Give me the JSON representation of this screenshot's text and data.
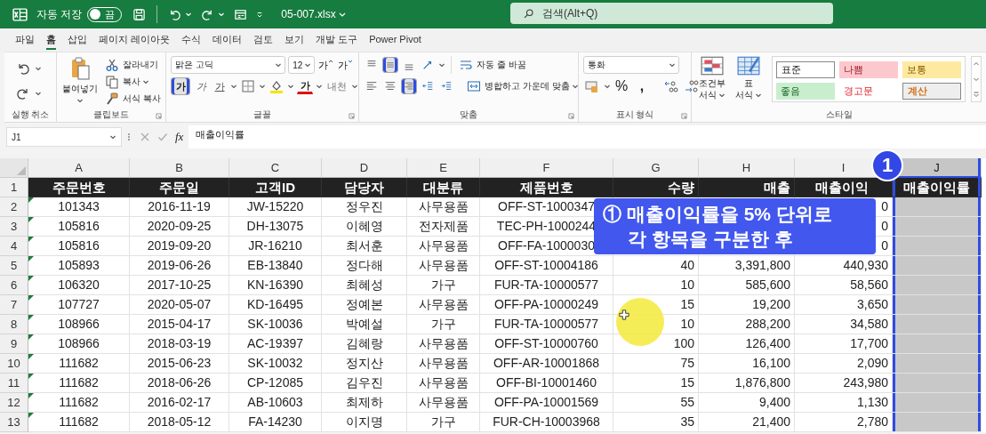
{
  "title_bar": {
    "autosave_label": "자동 저장",
    "autosave": {
      "on": false,
      "label": "끔"
    },
    "filename": "05-007.xlsx",
    "search": {
      "placeholder": "검색(Alt+Q)"
    }
  },
  "tabs": [
    {
      "label": "파일",
      "selected": false
    },
    {
      "label": "홈",
      "selected": true
    },
    {
      "label": "삽입",
      "selected": false
    },
    {
      "label": "페이지 레이아웃",
      "selected": false
    },
    {
      "label": "수식",
      "selected": false
    },
    {
      "label": "데이터",
      "selected": false
    },
    {
      "label": "검토",
      "selected": false
    },
    {
      "label": "보기",
      "selected": false
    },
    {
      "label": "개발 도구",
      "selected": false
    },
    {
      "label": "Power Pivot",
      "selected": false
    }
  ],
  "ribbon": {
    "undo": {
      "label": "실행 취소"
    },
    "clipboard": {
      "label": "클립보드",
      "paste": "붙여넣기",
      "items": [
        {
          "kind": "cut",
          "label": "잘라내기"
        },
        {
          "kind": "copy",
          "label": "복사"
        },
        {
          "kind": "painter",
          "label": "서식 복사"
        }
      ]
    },
    "font": {
      "label": "글꼴",
      "family": "맑은 고딕",
      "size": "12",
      "size_buttons": [
        {
          "kind": "grow",
          "text": "가"
        },
        {
          "kind": "shrink",
          "text": "가"
        }
      ],
      "buttons": [
        {
          "kind": "bold",
          "text": "가",
          "selected": true
        },
        {
          "kind": "italic",
          "text": "가",
          "selected": false
        },
        {
          "kind": "underline",
          "text": "가",
          "selected": false
        },
        {
          "kind": "border",
          "selected": false
        },
        {
          "kind": "fill",
          "selected": false
        },
        {
          "kind": "color",
          "text": "가",
          "selected": false
        },
        {
          "kind": "phonetic",
          "text": "내천",
          "selected": false
        }
      ]
    },
    "alignment": {
      "label": "맞춤",
      "top_buttons": [
        {
          "kind": "top",
          "selected": false
        },
        {
          "kind": "middle",
          "selected": true
        },
        {
          "kind": "bottom",
          "selected": false
        },
        {
          "kind": "orient",
          "selected": false
        }
      ],
      "bottom_buttons": [
        {
          "kind": "left",
          "selected": false
        },
        {
          "kind": "center",
          "selected": false
        },
        {
          "kind": "right",
          "selected": true
        },
        {
          "kind": "outdent",
          "selected": false
        },
        {
          "kind": "indent",
          "selected": false
        }
      ],
      "wrap": "자동 줄 바꿈",
      "merge": "병합하고 가운데 맞춤"
    },
    "number": {
      "label": "표시 형식",
      "format": "통화",
      "percent": "%",
      "comma": ","
    },
    "styles": {
      "label": "스타일",
      "conditional": [
        "조건부",
        "서식"
      ],
      "table": [
        "표",
        "서식"
      ],
      "cells": [
        {
          "label": "표준",
          "kind": "normal"
        },
        {
          "label": "나쁨",
          "kind": "bad"
        },
        {
          "label": "보통",
          "kind": "neutral"
        },
        {
          "label": "좋음",
          "kind": "good"
        },
        {
          "label": "경고문",
          "kind": "warning"
        },
        {
          "label": "계산",
          "kind": "calc"
        }
      ]
    }
  },
  "formula_bar": {
    "name_box": "J1",
    "fx": "fx",
    "formula": "매출이익률"
  },
  "sheet": {
    "columns": [
      {
        "letter": "A",
        "kind": "text",
        "selected": false
      },
      {
        "letter": "B",
        "kind": "text",
        "selected": false
      },
      {
        "letter": "C",
        "kind": "text",
        "selected": false
      },
      {
        "letter": "D",
        "kind": "text",
        "selected": false
      },
      {
        "letter": "E",
        "kind": "text",
        "selected": false
      },
      {
        "letter": "F",
        "kind": "text",
        "selected": false
      },
      {
        "letter": "G",
        "kind": "number",
        "selected": false
      },
      {
        "letter": "H",
        "kind": "number",
        "selected": false
      },
      {
        "letter": "I",
        "kind": "number",
        "selected": false
      },
      {
        "letter": "J",
        "kind": "text",
        "selected": true
      }
    ],
    "rows": [
      {
        "number": "1",
        "kind": "header",
        "flag": false,
        "cells": [
          "주문번호",
          "주문일",
          "고객ID",
          "담당자",
          "대분류",
          "제품번호",
          "수량",
          "매출",
          "매출이익",
          "매출이익률"
        ]
      },
      {
        "number": "2",
        "kind": "data",
        "flag": true,
        "cells": [
          "101343",
          "2016-11-19",
          "JW-15220",
          "정우진",
          "사무용품",
          "OFF-ST-1000347",
          null,
          null,
          "0",
          null
        ]
      },
      {
        "number": "3",
        "kind": "data",
        "flag": true,
        "cells": [
          "105816",
          "2020-09-25",
          "DH-13075",
          "이혜영",
          "전자제품",
          "TEC-PH-1000244",
          null,
          null,
          "0",
          null
        ]
      },
      {
        "number": "4",
        "kind": "data",
        "flag": true,
        "cells": [
          "105816",
          "2019-09-20",
          "JR-16210",
          "최서훈",
          "사무용품",
          "OFF-FA-1000030",
          null,
          null,
          "0",
          null
        ]
      },
      {
        "number": "5",
        "kind": "data",
        "flag": true,
        "cells": [
          "105893",
          "2019-06-26",
          "EB-13840",
          "정다해",
          "사무용품",
          "OFF-ST-10004186",
          "40",
          "3,391,800",
          "440,930",
          null
        ]
      },
      {
        "number": "6",
        "kind": "data",
        "flag": true,
        "cells": [
          "106320",
          "2017-10-25",
          "KN-16390",
          "최혜성",
          "가구",
          "FUR-TA-10000577",
          "10",
          "585,600",
          "58,560",
          null
        ]
      },
      {
        "number": "7",
        "kind": "data",
        "flag": true,
        "cells": [
          "107727",
          "2020-05-07",
          "KD-16495",
          "정예본",
          "사무용품",
          "OFF-PA-10000249",
          "15",
          "19,200",
          "3,650",
          null
        ]
      },
      {
        "number": "8",
        "kind": "data",
        "flag": true,
        "cells": [
          "108966",
          "2015-04-17",
          "SK-10036",
          "박예설",
          "가구",
          "FUR-TA-10000577",
          "10",
          "288,200",
          "34,580",
          null
        ]
      },
      {
        "number": "9",
        "kind": "data",
        "flag": true,
        "cells": [
          "108966",
          "2018-03-19",
          "AC-19397",
          "김혜랑",
          "사무용품",
          "OFF-ST-10000760",
          "100",
          "126,400",
          "17,700",
          null
        ]
      },
      {
        "number": "10",
        "kind": "data",
        "flag": true,
        "cells": [
          "111682",
          "2015-06-23",
          "SK-10032",
          "정지산",
          "사무용품",
          "OFF-AR-10001868",
          "75",
          "16,100",
          "2,090",
          null
        ]
      },
      {
        "number": "11",
        "kind": "data",
        "flag": true,
        "cells": [
          "111682",
          "2018-06-26",
          "CP-12085",
          "김우진",
          "사무용품",
          "OFF-BI-10001460",
          "15",
          "1,876,800",
          "243,980",
          null
        ]
      },
      {
        "number": "12",
        "kind": "data",
        "flag": true,
        "cells": [
          "111682",
          "2016-02-17",
          "AB-10603",
          "최제하",
          "사무용품",
          "OFF-PA-10001569",
          "55",
          "9,400",
          "1,130",
          null
        ]
      },
      {
        "number": "13",
        "kind": "data",
        "flag": true,
        "cells": [
          "111682",
          "2018-05-12",
          "FA-14230",
          "이지명",
          "가구",
          "FUR-CH-10003968",
          "35",
          "21,400",
          "2,780",
          null
        ]
      }
    ]
  },
  "callout": {
    "lines": [
      "① 매출이익률을 5% 단위로",
      "각 항목을 구분한 후"
    ]
  },
  "badge": {
    "text": "1"
  }
}
